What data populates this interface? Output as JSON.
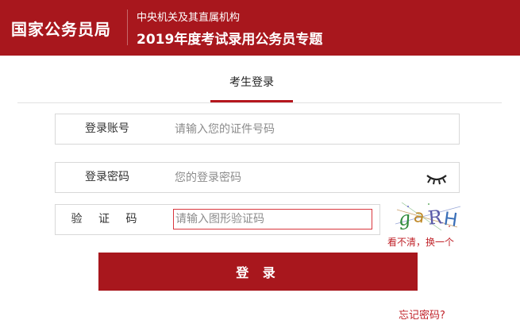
{
  "header": {
    "brand": "国家公务员局",
    "subtitle_small": "中央机关及其直属机构",
    "subtitle_large": "2019年度考试录用公务员专题"
  },
  "tabs": [
    {
      "label": "考生登录"
    }
  ],
  "form": {
    "account": {
      "label": "登录账号",
      "placeholder": "请输入您的证件号码"
    },
    "password": {
      "label": "登录密码",
      "placeholder": "您的登录密码",
      "toggle_icon": "eye-closed-icon"
    },
    "captcha": {
      "label": "验 证 码",
      "placeholder": "请输入图形验证码",
      "image_text": "gaRH",
      "refresh_label": "看不清，换一个"
    },
    "submit_label": "登 录",
    "forgot_label": "忘记密码?"
  },
  "colors": {
    "brand": "#a8171d",
    "accent_text": "#c0232a"
  }
}
